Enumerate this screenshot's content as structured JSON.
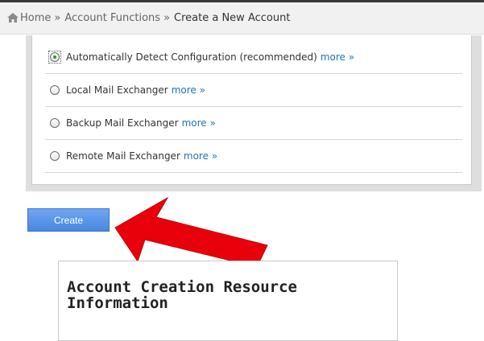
{
  "breadcrumb": {
    "icon": "home-icon",
    "home": "Home",
    "separator": "»",
    "section": "Account Functions",
    "current": "Create a New Account"
  },
  "mail_routing": {
    "options": [
      {
        "label": "Automatically Detect Configuration (recommended)",
        "more": "more »",
        "selected": true
      },
      {
        "label": "Local Mail Exchanger",
        "more": "more »",
        "selected": false
      },
      {
        "label": "Backup Mail Exchanger",
        "more": "more »",
        "selected": false
      },
      {
        "label": "Remote Mail Exchanger",
        "more": "more »",
        "selected": false
      }
    ]
  },
  "actions": {
    "create_label": "Create"
  },
  "annotation": {
    "arrow_color": "#e8000b",
    "arrow_points_to": "create-button"
  },
  "resource_info": {
    "title": "Account Creation Resource Information"
  },
  "colors": {
    "link": "#1d76b5",
    "button": "#4a86e2",
    "radio_selected": "#2a9a2a"
  }
}
